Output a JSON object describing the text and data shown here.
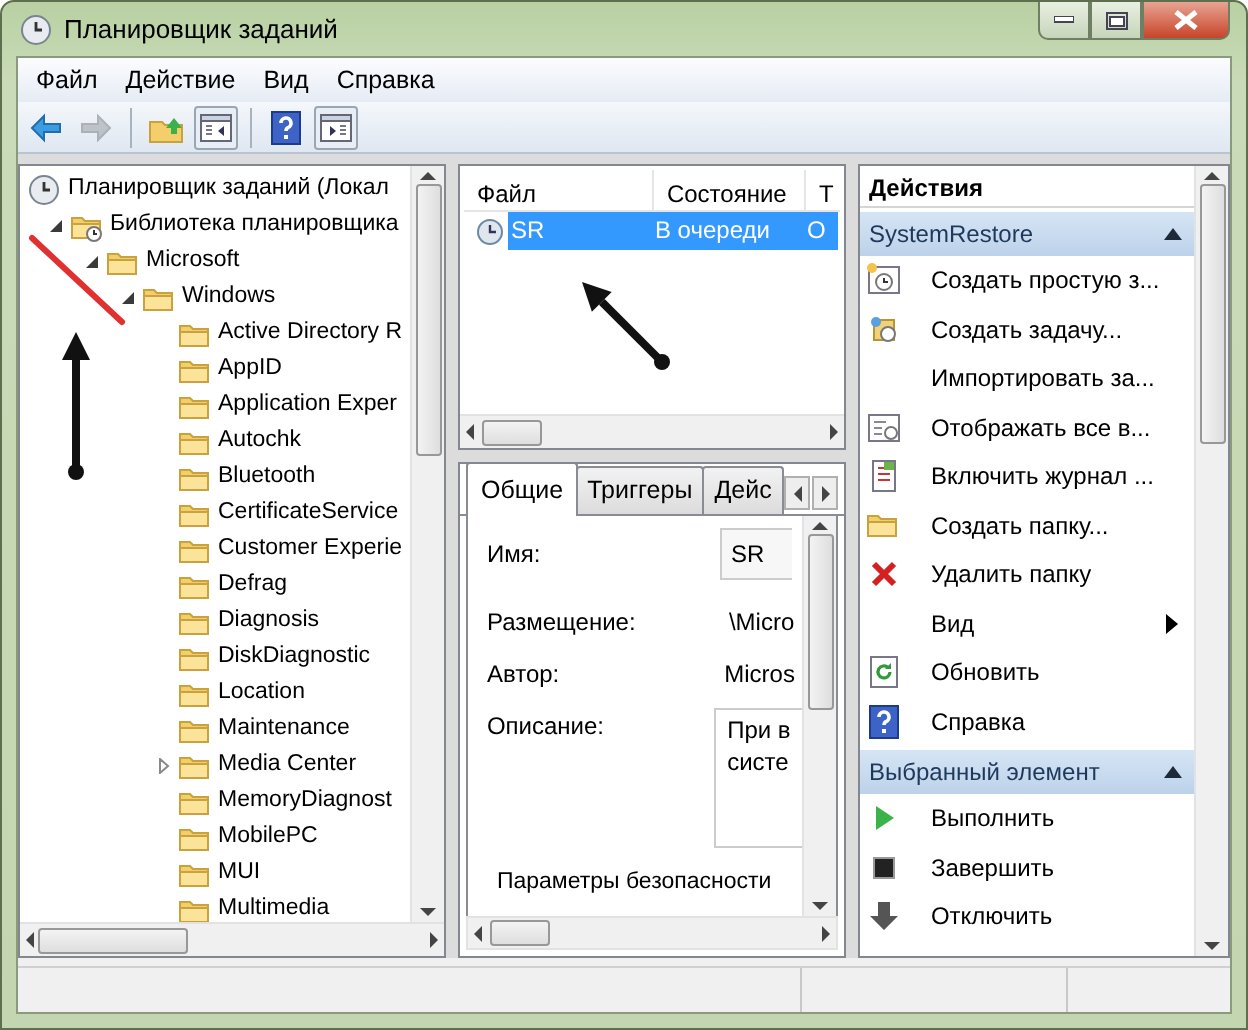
{
  "window": {
    "title": "Планировщик заданий"
  },
  "menu": [
    "Файл",
    "Действие",
    "Вид",
    "Справка"
  ],
  "toolbar": [
    {
      "kind": "back",
      "disabled": false
    },
    {
      "kind": "forward",
      "disabled": true
    },
    {
      "kind": "separator"
    },
    {
      "kind": "up",
      "disabled": false
    },
    {
      "kind": "tree",
      "disabled": false
    },
    {
      "kind": "separator"
    },
    {
      "kind": "help",
      "disabled": false
    },
    {
      "kind": "panel",
      "disabled": false
    }
  ],
  "tree": [
    {
      "label": "Планировщик заданий (Локал",
      "children": [
        {
          "label": "Библиотека планировщика",
          "expanded": true,
          "children": [
            {
              "label": "Microsoft",
              "expanded": true,
              "children": [
                {
                  "label": "Windows",
                  "expanded": true,
                  "children": [
                    {
                      "label": "Active Directory R"
                    },
                    {
                      "label": "AppID"
                    },
                    {
                      "label": "Application Exper"
                    },
                    {
                      "label": "Autochk"
                    },
                    {
                      "label": "Bluetooth"
                    },
                    {
                      "label": "CertificateService"
                    },
                    {
                      "label": "Customer Experie"
                    },
                    {
                      "label": "Defrag"
                    },
                    {
                      "label": "Diagnosis"
                    },
                    {
                      "label": "DiskDiagnostic"
                    },
                    {
                      "label": "Location"
                    },
                    {
                      "label": "Maintenance"
                    },
                    {
                      "label": "Media Center",
                      "expanded": false
                    },
                    {
                      "label": "MemoryDiagnost"
                    },
                    {
                      "label": "MobilePC"
                    },
                    {
                      "label": "MUI"
                    },
                    {
                      "label": "Multimedia"
                    }
                  ]
                }
              ]
            }
          ]
        }
      ]
    }
  ],
  "task_list": {
    "columns": [
      "Файл",
      "Состояние",
      "Т"
    ],
    "rows": [
      {
        "cells": [
          "SR",
          "В очереди",
          "О"
        ],
        "selected": true
      }
    ]
  },
  "details": {
    "tabs": [
      {
        "label": "Общие",
        "selected": true
      },
      {
        "label": "Триггеры",
        "selected": false
      },
      {
        "label": "Дейс",
        "selected": false
      }
    ],
    "fields": [
      {
        "label": "Имя:",
        "value": "SR",
        "kind": "box"
      },
      {
        "label": "Размещение:",
        "value": "\\Micro",
        "kind": "plain"
      },
      {
        "label": "Автор:",
        "value": "Micros",
        "kind": "plain"
      },
      {
        "label": "Описание:",
        "value": "При в\nсисте",
        "kind": "area"
      }
    ],
    "section": "Параметры безопасности"
  },
  "actions": {
    "title": "Действия",
    "sections": [
      {
        "title": "SystemRestore",
        "expanded": true,
        "items": [
          {
            "label": "Создать простую з...",
            "submenu": false
          },
          {
            "label": "Создать задачу...",
            "submenu": false
          },
          {
            "label": "Импортировать за...",
            "submenu": false
          },
          {
            "label": "Отображать все в...",
            "submenu": false
          },
          {
            "label": "Включить журнал ...",
            "submenu": false
          },
          {
            "label": "Создать папку...",
            "submenu": false
          },
          {
            "label": "Удалить папку",
            "submenu": false
          },
          {
            "label": "Вид",
            "submenu": true
          },
          {
            "label": "Обновить",
            "submenu": false
          },
          {
            "label": "Справка",
            "submenu": false
          }
        ]
      },
      {
        "title": "Выбранный элемент",
        "expanded": true,
        "items": [
          {
            "label": "Выполнить",
            "submenu": false
          },
          {
            "label": "Завершить",
            "submenu": false
          },
          {
            "label": "Отключить",
            "submenu": false
          }
        ]
      }
    ]
  },
  "annotations": [
    {
      "kind": "line",
      "color": "#e03030"
    },
    {
      "kind": "arrow",
      "color": "#111111"
    },
    {
      "kind": "arrow",
      "color": "#111111"
    }
  ]
}
